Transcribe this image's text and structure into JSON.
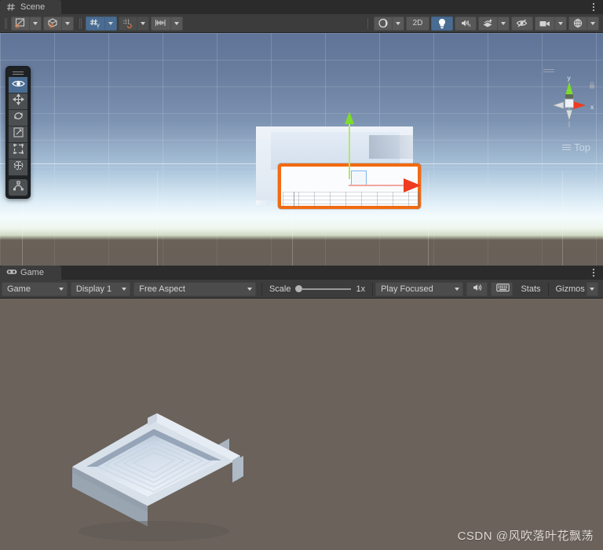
{
  "scene_panel": {
    "tab_label": "Scene",
    "tab_icon": "grid-hash-icon",
    "kebab_label": "more-options",
    "toolbar": {
      "tools": [
        {
          "name": "draw-mode",
          "icon": "shaded-wireframe-icon",
          "has_dropdown": true,
          "active": false
        },
        {
          "name": "render-mode",
          "icon": "cube-shading-icon",
          "has_dropdown": true,
          "active": false
        },
        {
          "name": "grid-axis",
          "icon": "grid-y-axis-icon",
          "label": "Y",
          "has_dropdown": true,
          "active": true
        },
        {
          "name": "grid-snapping",
          "icon": "grid-snap-icon",
          "has_dropdown": true,
          "active": false
        },
        {
          "name": "snap-increment",
          "icon": "ruler-increment-icon",
          "has_dropdown": true,
          "active": false
        }
      ],
      "right_tools": [
        {
          "name": "scene-visibility-shading",
          "icon": "half-sphere-icon",
          "has_dropdown": true,
          "active": false
        },
        {
          "name": "2d-toggle",
          "icon": "text-2d",
          "label": "2D",
          "has_dropdown": false,
          "active": false
        },
        {
          "name": "lighting-toggle",
          "icon": "lightbulb-icon",
          "has_dropdown": false,
          "active": true
        },
        {
          "name": "audio-toggle",
          "icon": "speaker-muted-icon",
          "has_dropdown": false,
          "active": false
        },
        {
          "name": "effects-toggle",
          "icon": "fx-sparkle-icon",
          "has_dropdown": true,
          "active": false
        },
        {
          "name": "scene-visibility-toggle",
          "icon": "eye-slash-icon",
          "has_dropdown": false,
          "active": false
        },
        {
          "name": "camera-settings",
          "icon": "camera-icon",
          "has_dropdown": true,
          "active": false
        },
        {
          "name": "gizmos-toggle",
          "icon": "gizmo-globe-icon",
          "has_dropdown": true,
          "active": false
        }
      ]
    },
    "tool_palette": [
      {
        "name": "view-tool",
        "icon": "eye-icon",
        "active": true
      },
      {
        "name": "move-tool",
        "icon": "move-arrows-icon",
        "active": false
      },
      {
        "name": "rotate-tool",
        "icon": "rotate-arrows-icon",
        "active": false
      },
      {
        "name": "scale-tool",
        "icon": "scale-arrow-box-icon",
        "active": false
      },
      {
        "name": "rect-tool",
        "icon": "rect-transform-icon",
        "active": false
      },
      {
        "name": "transform-tool",
        "icon": "combined-transform-icon",
        "active": false
      },
      {
        "name": "custom-editor-tool",
        "icon": "editor-tool-icon",
        "active": false
      }
    ],
    "gizmo": {
      "view_label": "Top",
      "axis_y_label": "y",
      "axis_x_label": "x",
      "lock_icon": "padlock-icon"
    },
    "viewport": {
      "selection_outline_color": "#f26a11",
      "axis_y_color": "#7ddd2a",
      "axis_x_color": "#ef3b1f",
      "sky_top_color": "#5f7498",
      "ground_color": "#686059"
    }
  },
  "game_panel": {
    "tab_label": "Game",
    "tab_icon": "gamepad-icon",
    "kebab_label": "more-options",
    "toolbar": {
      "view_mode": {
        "name": "game-view-selector",
        "value": "Game",
        "has_dropdown": true
      },
      "display": {
        "name": "display-selector",
        "value": "Display 1",
        "has_dropdown": true
      },
      "aspect": {
        "name": "aspect-selector",
        "value": "Free Aspect",
        "has_dropdown": true
      },
      "scale": {
        "name": "scale-slider",
        "label": "Scale",
        "value": "1x"
      },
      "play_mode": {
        "name": "play-mode-selector",
        "value": "Play Focused",
        "has_dropdown": true
      },
      "mute_audio": {
        "name": "mute-audio-button",
        "icon": "speaker-icon"
      },
      "keyboard_input": {
        "name": "keyboard-input-button",
        "icon": "keyboard-icon"
      },
      "stats": {
        "name": "stats-button",
        "label": "Stats"
      },
      "gizmos": {
        "name": "gizmos-button",
        "label": "Gizmos",
        "has_dropdown": true
      }
    },
    "viewport": {
      "background_color": "#6a625b",
      "object_name": "white-open-box-mesh"
    },
    "watermark": "CSDN @风吹落叶花飘荡"
  }
}
